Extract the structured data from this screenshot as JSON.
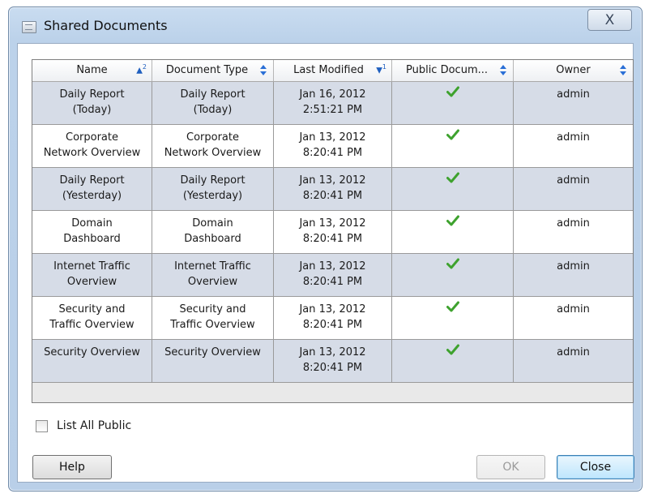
{
  "window": {
    "title": "Shared Documents",
    "close_glyph": "X"
  },
  "table": {
    "columns": [
      {
        "label": "Name",
        "sort": "ascending",
        "sort_rank": "2"
      },
      {
        "label": "Document Type",
        "sort": "none"
      },
      {
        "label": "Last Modified",
        "sort": "descending",
        "sort_rank": "1"
      },
      {
        "label": "Public Docum...",
        "sort": "none"
      },
      {
        "label": "Owner",
        "sort": "none"
      }
    ],
    "rows": [
      {
        "name": "Daily Report\n(Today)",
        "type": "Daily Report\n(Today)",
        "modified": "Jan 16, 2012\n2:51:21 PM",
        "public": true,
        "owner": "admin"
      },
      {
        "name": "Corporate\nNetwork Overview",
        "type": "Corporate\nNetwork Overview",
        "modified": "Jan 13, 2012\n8:20:41 PM",
        "public": true,
        "owner": "admin"
      },
      {
        "name": "Daily Report\n(Yesterday)",
        "type": "Daily Report\n(Yesterday)",
        "modified": "Jan 13, 2012\n8:20:41 PM",
        "public": true,
        "owner": "admin"
      },
      {
        "name": "Domain\nDashboard",
        "type": "Domain\nDashboard",
        "modified": "Jan 13, 2012\n8:20:41 PM",
        "public": true,
        "owner": "admin"
      },
      {
        "name": "Internet Traffic\nOverview",
        "type": "Internet Traffic\nOverview",
        "modified": "Jan 13, 2012\n8:20:41 PM",
        "public": true,
        "owner": "admin"
      },
      {
        "name": "Security and\nTraffic Overview",
        "type": "Security and\nTraffic Overview",
        "modified": "Jan 13, 2012\n8:20:41 PM",
        "public": true,
        "owner": "admin"
      },
      {
        "name": "Security Overview",
        "type": "Security Overview",
        "modified": "Jan 13, 2012\n8:20:41 PM",
        "public": true,
        "owner": "admin"
      }
    ]
  },
  "list_all_public": {
    "label": "List All Public",
    "checked": false
  },
  "buttons": {
    "help": "Help",
    "ok": "OK",
    "close": "Close"
  },
  "colors": {
    "check": "#3ea22e",
    "shaded_row": "#d6dce7",
    "sort_arrow": "#2a6fd6"
  }
}
